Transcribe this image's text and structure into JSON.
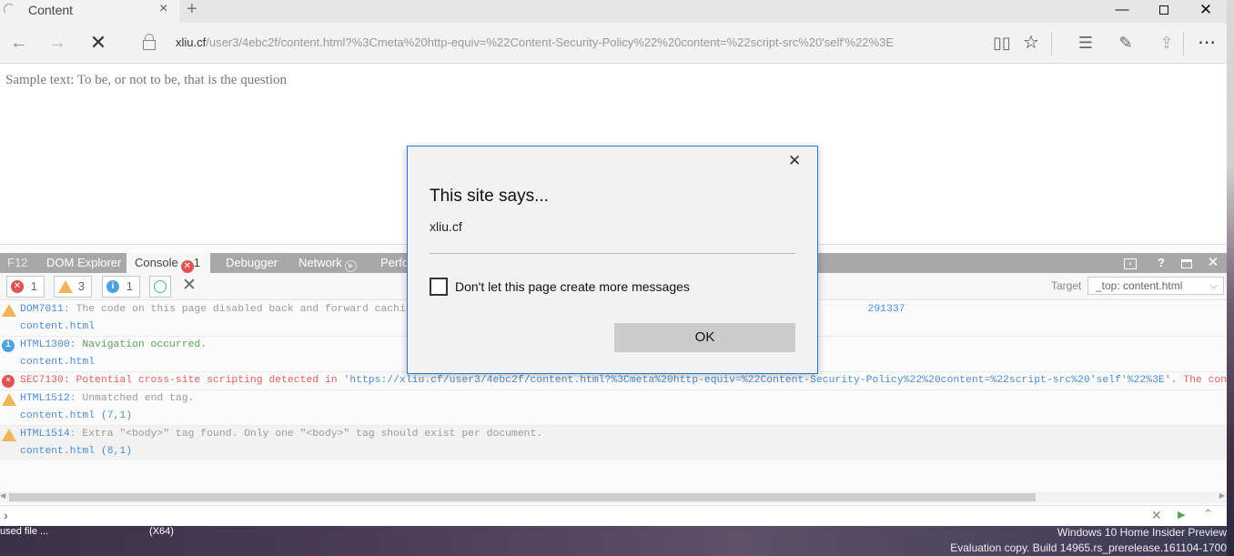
{
  "browser": {
    "tab_title": "Content",
    "tab_close_icon": "×",
    "new_tab_icon": "+",
    "url_host": "xliu.cf",
    "url_path": "/user3/4ebc2f/content.html?%3Cmeta%20http-equiv=%22Content-Security-Policy%22%20content=%22script-src%20'self'%22%3E",
    "window_controls": {
      "minimize": "—",
      "close": "✕"
    },
    "nav": {
      "back": "←",
      "forward": "→",
      "stop": "✕"
    },
    "toolbar": {
      "reading_view": "▯▯",
      "favorite": "☆",
      "hub": "☰",
      "note": "✎",
      "share": "⇪",
      "more": "⋯"
    }
  },
  "page": {
    "sample_text": "Sample text: To be, or not to be, that is the question"
  },
  "devtools": {
    "tabs": {
      "f12": "F12",
      "dom": "DOM Explorer",
      "console": "Console",
      "console_badge": "1",
      "debugger": "Debugger",
      "network": "Network",
      "perf": "Perfo"
    },
    "filters": {
      "errors": "1",
      "warnings": "3",
      "info": "1"
    },
    "clear_icon": "✕",
    "target_label": "Target",
    "target_value": "_top: content.html",
    "messages": [
      {
        "type": "warning",
        "code": "DOM7011",
        "text": ": The code on this page disabled back and forward caching",
        "trail": "291337",
        "source": "content.html"
      },
      {
        "type": "info",
        "code": "HTML1300",
        "text": ": Navigation occurred.",
        "source": "content.html"
      },
      {
        "type": "error",
        "code": "SEC7130",
        "text": ": Potential cross-site scripting detected in '",
        "url": "https://xliu.cf/user3/4ebc2f/content.html?%3Cmeta%20http-equiv=%22Content-Security-Policy%22%20content=%22script-src%20'self'%22%3E",
        "tail": "'. The content h"
      },
      {
        "type": "warning",
        "code": "HTML1512",
        "text": ": Unmatched end tag.",
        "source": "content.html (7,1)"
      },
      {
        "type": "warning",
        "code": "HTML1514",
        "text": ": Extra \"<body>\" tag found. Only one \"<body>\" tag should exist per document.",
        "source": "content.html (8,1)"
      }
    ],
    "prompt": "›"
  },
  "dialog": {
    "title": "This site says...",
    "message": "xliu.cf",
    "checkbox_label": "Don't let this page create more messages",
    "ok_label": "OK",
    "close_icon": "✕"
  },
  "taskbar": {
    "item1": "used file ...",
    "item2": "(X64)",
    "watermark_line1": "Windows 10 Home Insider Preview",
    "watermark_line2": "Evaluation copy. Build 14965.rs_prerelease.161104-1700"
  }
}
